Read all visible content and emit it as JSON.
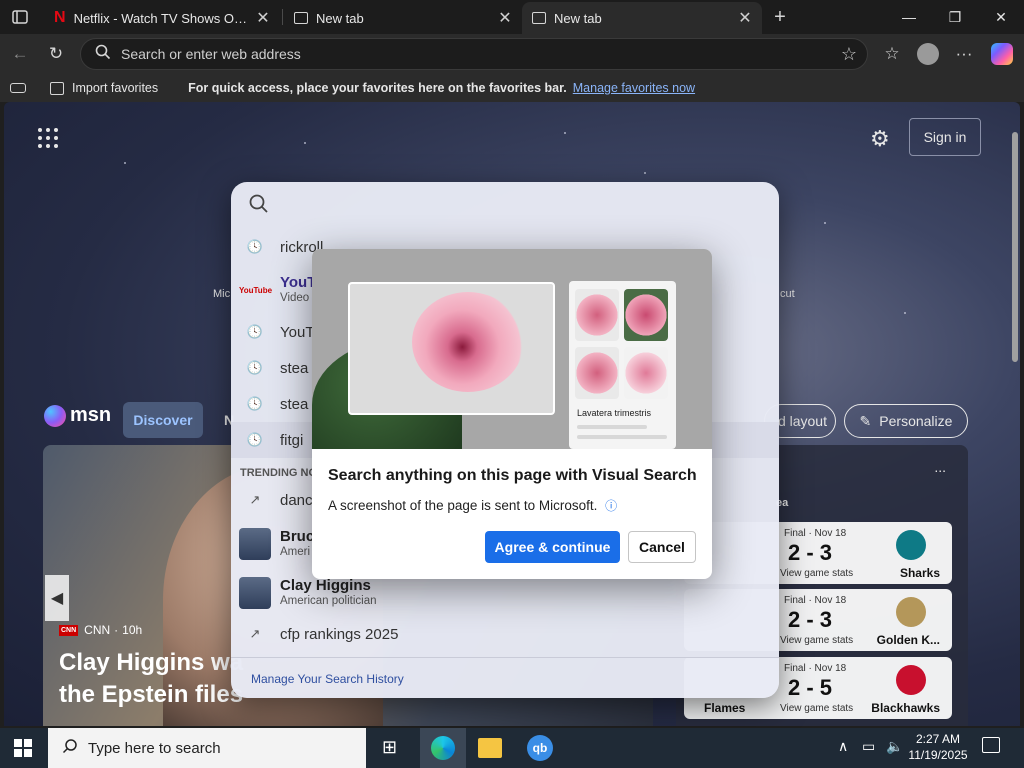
{
  "browser": {
    "tabs": [
      {
        "label": "Netflix - Watch TV Shows Online, Wa",
        "active": false
      },
      {
        "label": "New tab",
        "active": false
      },
      {
        "label": "New tab",
        "active": true
      }
    ],
    "address_placeholder": "Search or enter web address"
  },
  "favorites_bar": {
    "import_label": "Import favorites",
    "message": "For quick access, place your favorites here on the favorites bar.",
    "manage_link": "Manage favorites now"
  },
  "page": {
    "sign_in_label": "Sign in",
    "msn_logo": "msn",
    "discover_tab": "Discover",
    "discover_tab_partial": "N",
    "layout_button": "d layout",
    "personalize_button": "Personalize",
    "quicklinks_left_partial": "Mic",
    "quicklinks_right_partial": "cut",
    "story": {
      "source": "CNN",
      "age": "10h",
      "headline_line1": "Clay Higgins wa",
      "headline_line2": "the Epstein files"
    },
    "sports": {
      "header_partial": "ea",
      "more": "...",
      "games": [
        {
          "meta": "Final · Nov 18",
          "score": "2 - 3",
          "stats": "View game stats",
          "team": "Sharks",
          "left_team": ""
        },
        {
          "meta": "Final · Nov 18",
          "score": "2 - 3",
          "stats": "View game stats",
          "team": "Golden K...",
          "left_team": ""
        },
        {
          "meta": "Final · Nov 18",
          "score": "2 - 5",
          "stats": "View game stats",
          "team": "Blackhawks",
          "left_team": "Flames"
        }
      ]
    }
  },
  "search_dropdown": {
    "history": [
      {
        "text": "rickroll"
      },
      {
        "title": "YouT",
        "sub": "Video",
        "logo": "YouTube"
      },
      {
        "text": "YouT"
      },
      {
        "text": "stea"
      },
      {
        "text": "stea"
      },
      {
        "text": "fitgi"
      }
    ],
    "trending_label": "TRENDING NO",
    "trending": [
      {
        "text": "danc"
      },
      {
        "title": "Bruc",
        "sub": "Ameri"
      },
      {
        "title": "Clay Higgins",
        "sub": "American politician"
      },
      {
        "text": "cfp rankings 2025"
      }
    ],
    "manage_history_link": "Manage Your Search History"
  },
  "visual_search_modal": {
    "title": "Search anything on this page with Visual Search",
    "description": "A screenshot of the page is sent to Microsoft.",
    "result_caption": "Lavatera trimestris",
    "agree_button": "Agree & continue",
    "cancel_button": "Cancel"
  },
  "taskbar": {
    "search_placeholder": "Type here to search",
    "time": "2:27 AM",
    "date": "11/19/2025"
  },
  "colors": {
    "primary_button": "#1a6ee8",
    "link": "#8ab4f8"
  }
}
